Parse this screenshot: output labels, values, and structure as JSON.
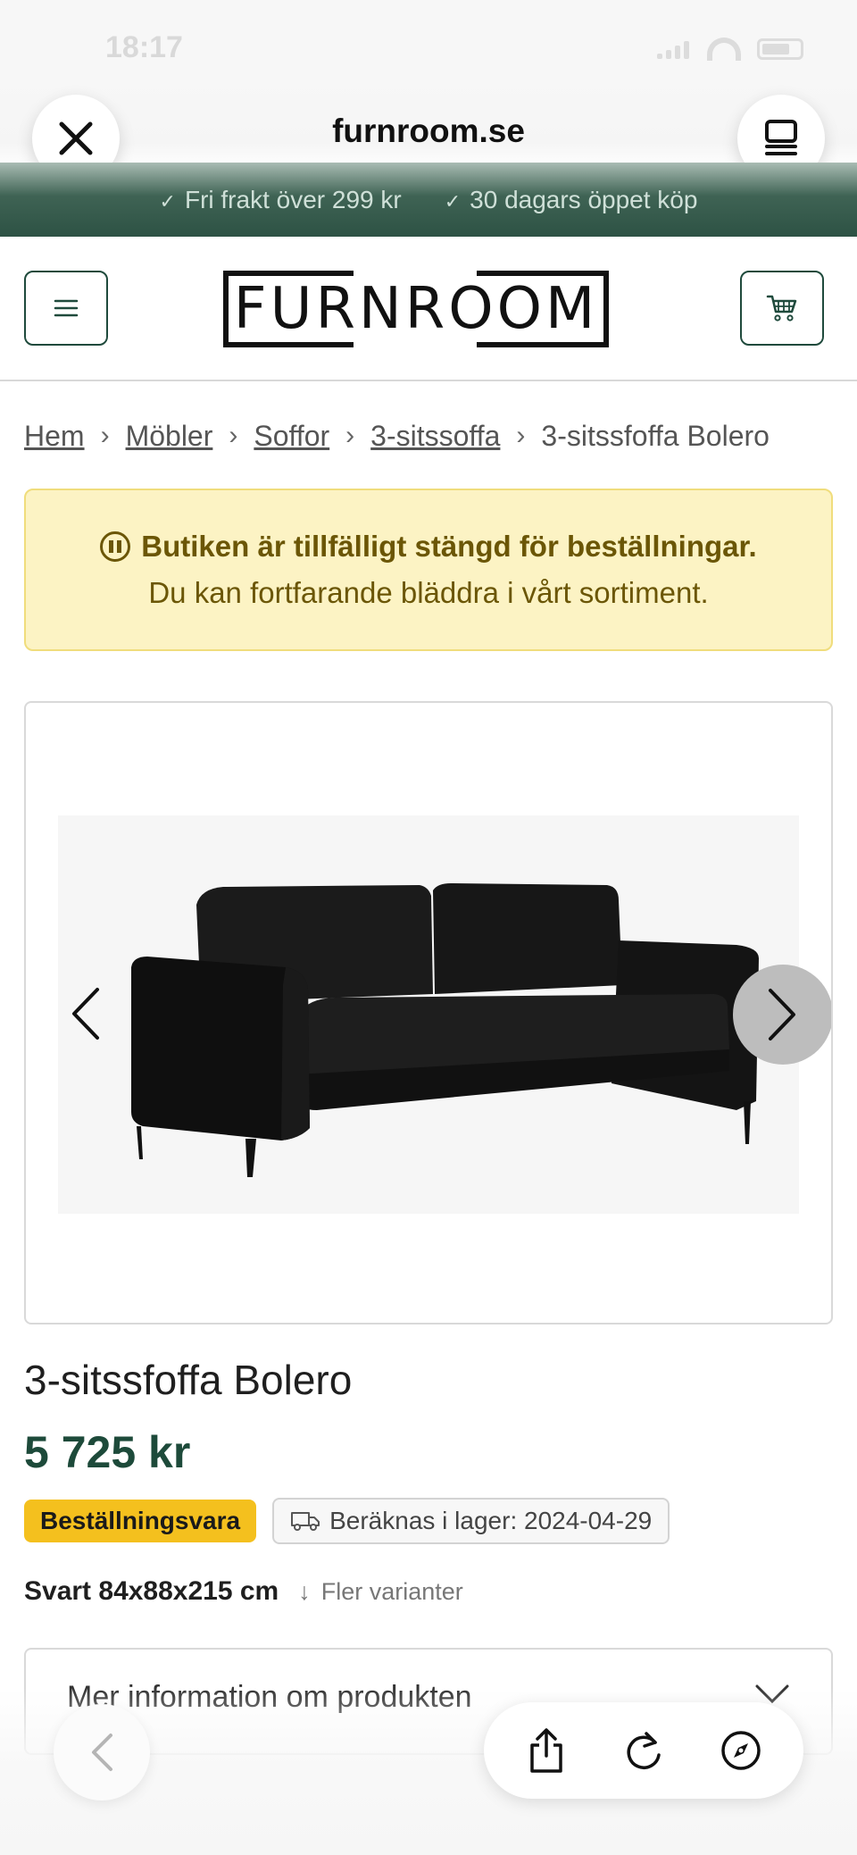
{
  "status_bar": {
    "time": "18:17"
  },
  "browser": {
    "url": "furnroom.se"
  },
  "promo": {
    "items": [
      "Fri frakt över 299 kr",
      "30 dagars öppet köp"
    ]
  },
  "header": {
    "logo_text": "FURNROOM"
  },
  "breadcrumb": {
    "items": [
      "Hem",
      "Möbler",
      "Soffor",
      "3-sitssoffa"
    ],
    "current": "3-sitssfoffa Bolero"
  },
  "notice": {
    "title": "Butiken är tillfälligt stängd för beställningar.",
    "subtitle": "Du kan fortfarande bläddra i vårt sortiment."
  },
  "product": {
    "title": "3-sitssfoffa Bolero",
    "price": "5 725 kr",
    "badge_order": "Beställningsvara",
    "stock_text": "Beräknas i lager: 2024-04-29",
    "variant": "Svart 84x88x215 cm",
    "more_variants": "Fler varianter",
    "accordion_label": "Mer information om produkten"
  },
  "colors": {
    "brand_green": "#1d4a3a",
    "notice_bg": "#fcf3c4",
    "badge_yellow": "#f4c01e"
  },
  "icons": {
    "close": "close-icon",
    "reader": "reader-icon",
    "menu": "menu-icon",
    "cart": "cart-icon",
    "pause": "pause-icon",
    "truck": "truck-icon",
    "share": "share-icon",
    "reload": "reload-icon",
    "compass": "compass-icon"
  }
}
